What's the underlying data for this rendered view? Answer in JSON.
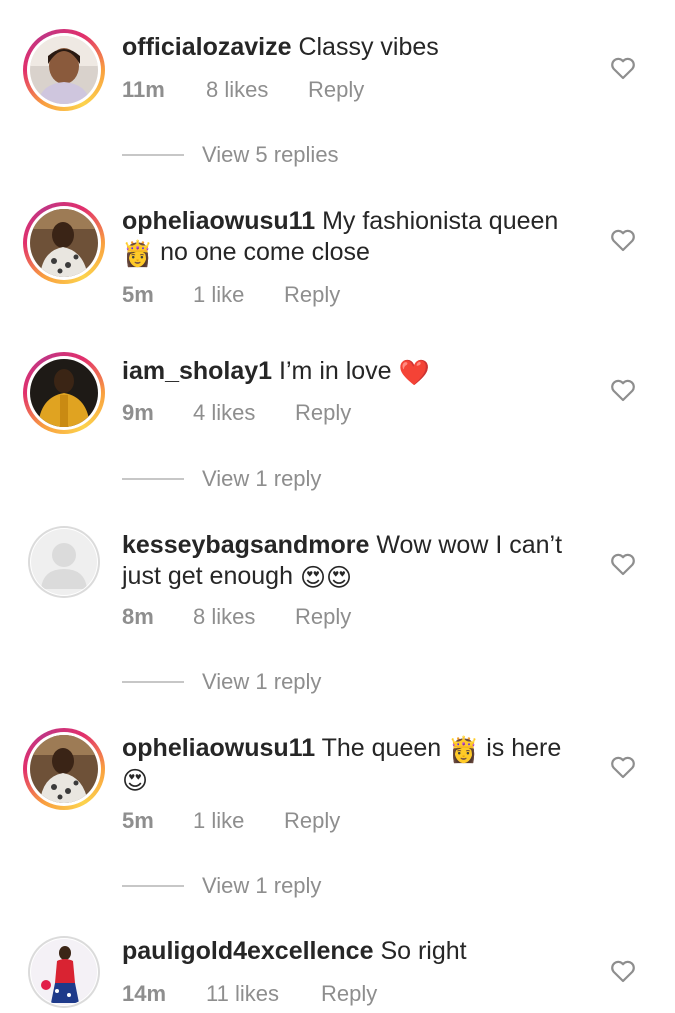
{
  "comments": [
    {
      "username": "officialozavize",
      "text": "Classy vibes",
      "time": "11m",
      "likes": "8 likes",
      "reply": "Reply",
      "view_replies": "View 5 replies"
    },
    {
      "username": "opheliaowusu11",
      "text_line1": "My fashionista queen",
      "text_line2": "no one come close",
      "emoji": "👸",
      "time": "5m",
      "likes": "1 like",
      "reply": "Reply"
    },
    {
      "username": "iam_sholay1",
      "text": "I’m in love",
      "emoji": "❤️",
      "time": "9m",
      "likes": "4 likes",
      "reply": "Reply",
      "view_replies": "View 1 reply"
    },
    {
      "username": "kesseybagsandmore",
      "text_line1": "Wow wow I can’t",
      "text_line2": "just get enough",
      "emoji": "😍😍",
      "time": "8m",
      "likes": "8 likes",
      "reply": "Reply",
      "view_replies": "View 1 reply"
    },
    {
      "username": "opheliaowusu11",
      "text_before": "The queen",
      "emoji_mid": "👸",
      "text_after": "is here",
      "emoji_end": "😍",
      "time": "5m",
      "likes": "1 like",
      "reply": "Reply",
      "view_replies": "View 1 reply"
    },
    {
      "username": "pauligold4excellence",
      "text": "So right",
      "time": "14m",
      "likes": "11 likes",
      "reply": "Reply"
    }
  ],
  "icons": {
    "like": "heart-outline-icon",
    "default_avatar": "default-avatar-icon"
  },
  "colors": {
    "text": "#262626",
    "secondary": "#8e8e8e",
    "story_ring": "#e1306c"
  }
}
